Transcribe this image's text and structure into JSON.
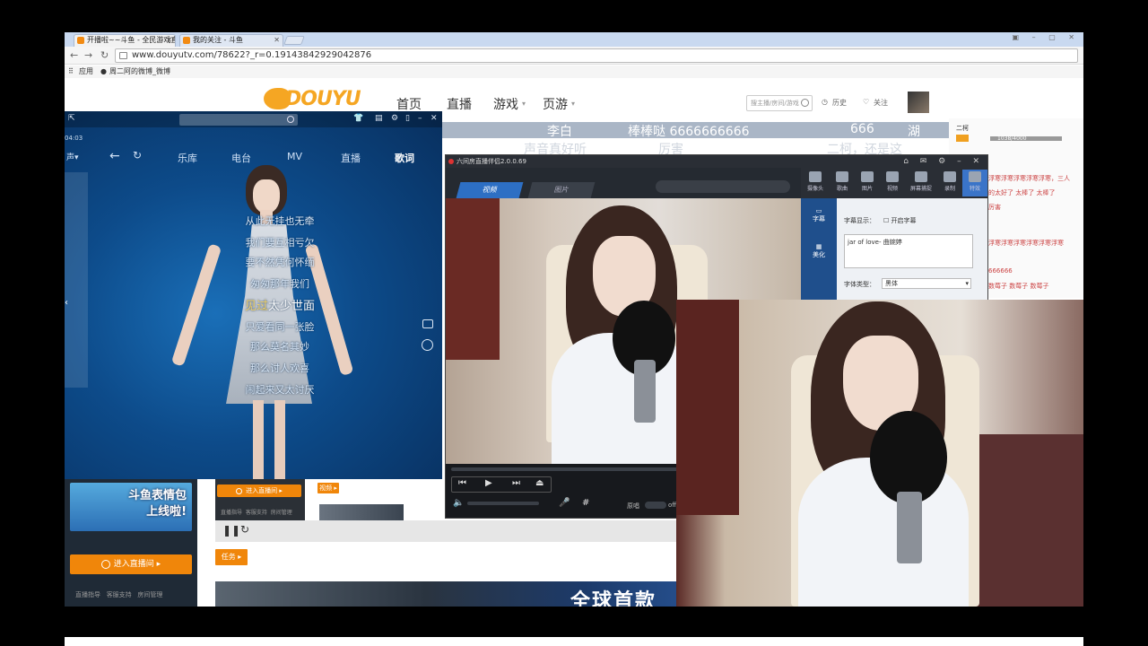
{
  "browser": {
    "tabs": [
      {
        "title": "开播啦~~斗鱼 - 全民游戏直"
      },
      {
        "title": "我的关注 - 斗鱼"
      }
    ],
    "url": "www.douyutv.com/78622?_r=0.19143842929042876",
    "bookmarks": [
      "应用",
      "周二阿的微博_微博"
    ]
  },
  "douyu": {
    "logo": "DOUYU",
    "nav": [
      "首页",
      "直播",
      "游戏",
      "页游"
    ],
    "search_placeholder": "搜主播/房间/游戏",
    "history": "历史",
    "follow": "关注",
    "danmu": [
      "李白",
      "棒棒哒 6666666666",
      "666",
      "湖",
      "声音真好听",
      "厉害",
      "二柯，还是这"
    ],
    "chat": {
      "user": "二柯",
      "progress_text": "1038/4000",
      "lines": [
        "浮寒浮寒浮寒浮寒浮寒，三人",
        "的太好了 太棒了 太棒了",
        "厉害",
        "浮寒浮寒浮寒浮寒浮寒浮寒",
        "666666",
        "数莓子 数莓子 数莓子",
        "浮寒浮寒浮寒浮寒浮寒浮寒"
      ]
    },
    "promo_text": [
      "斗鱼表情包",
      "上线啦!"
    ],
    "enter_room": "进入直播间",
    "enter_room_small": "进入直播间",
    "links_left": [
      "直播指导",
      "客服支持",
      "房间管理"
    ],
    "links_mid": [
      "直播指导",
      "客服支持",
      "房间管理"
    ],
    "badge_video": "视频",
    "badge_task": "任务",
    "game_banner": "全球首款"
  },
  "music_player": {
    "time": "04:03",
    "tabs": [
      "乐库",
      "电台",
      "MV",
      "直播",
      "歌词"
    ],
    "active_tab": "歌词",
    "lyrics": [
      "从此无挂也无牵",
      "我们要互相亏欠",
      "要不然凭何怀缅",
      "匆匆那年我们",
      "见过太少世面",
      "只爱看同一张脸",
      "那么莫名其妙",
      "那么讨人欢喜",
      "闹起来又太讨厌"
    ],
    "current_index": 4,
    "current_highlight": "见过"
  },
  "broadcast_tool": {
    "title": "六间房直播伴侣2.0.0.69",
    "tabs": [
      "视频",
      "图片"
    ],
    "active_tab": "视频",
    "toolbar": [
      "摄像头",
      "歌曲",
      "图片",
      "视频",
      "屏幕捕捉",
      "录制",
      "特效"
    ],
    "side_nav": [
      "字幕",
      "美化"
    ],
    "subtitle_label": "字幕显示：",
    "subtitle_toggle": "开启字幕",
    "subtitle_text": "jar of love- 曲婉婷",
    "font_label": "字体类型：",
    "font_value": "黑体",
    "player_labels": [
      "原唱",
      "off"
    ]
  }
}
